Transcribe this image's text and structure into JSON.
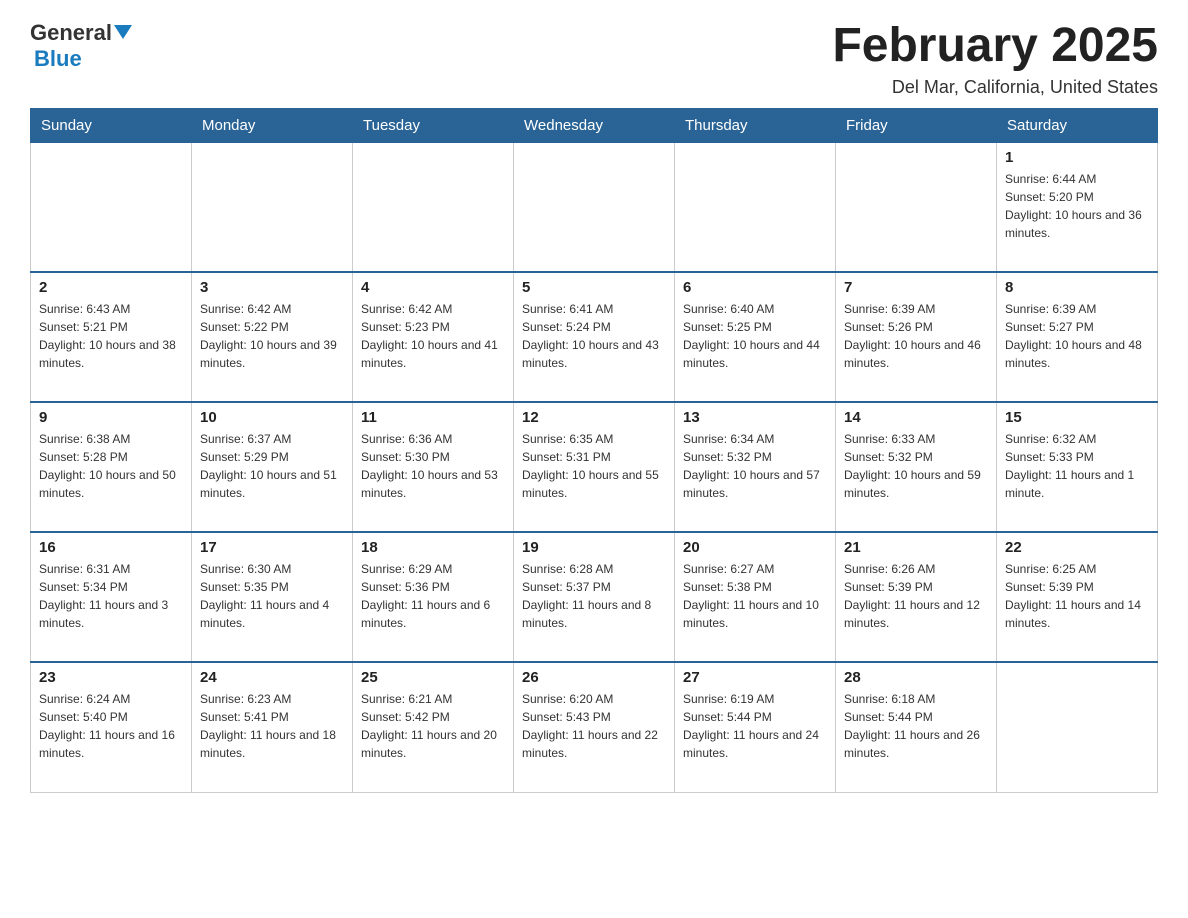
{
  "header": {
    "logo_general": "General",
    "logo_blue": "Blue",
    "month_title": "February 2025",
    "location": "Del Mar, California, United States"
  },
  "weekdays": [
    "Sunday",
    "Monday",
    "Tuesday",
    "Wednesday",
    "Thursday",
    "Friday",
    "Saturday"
  ],
  "weeks": [
    [
      {
        "day": "",
        "info": ""
      },
      {
        "day": "",
        "info": ""
      },
      {
        "day": "",
        "info": ""
      },
      {
        "day": "",
        "info": ""
      },
      {
        "day": "",
        "info": ""
      },
      {
        "day": "",
        "info": ""
      },
      {
        "day": "1",
        "info": "Sunrise: 6:44 AM\nSunset: 5:20 PM\nDaylight: 10 hours and 36 minutes."
      }
    ],
    [
      {
        "day": "2",
        "info": "Sunrise: 6:43 AM\nSunset: 5:21 PM\nDaylight: 10 hours and 38 minutes."
      },
      {
        "day": "3",
        "info": "Sunrise: 6:42 AM\nSunset: 5:22 PM\nDaylight: 10 hours and 39 minutes."
      },
      {
        "day": "4",
        "info": "Sunrise: 6:42 AM\nSunset: 5:23 PM\nDaylight: 10 hours and 41 minutes."
      },
      {
        "day": "5",
        "info": "Sunrise: 6:41 AM\nSunset: 5:24 PM\nDaylight: 10 hours and 43 minutes."
      },
      {
        "day": "6",
        "info": "Sunrise: 6:40 AM\nSunset: 5:25 PM\nDaylight: 10 hours and 44 minutes."
      },
      {
        "day": "7",
        "info": "Sunrise: 6:39 AM\nSunset: 5:26 PM\nDaylight: 10 hours and 46 minutes."
      },
      {
        "day": "8",
        "info": "Sunrise: 6:39 AM\nSunset: 5:27 PM\nDaylight: 10 hours and 48 minutes."
      }
    ],
    [
      {
        "day": "9",
        "info": "Sunrise: 6:38 AM\nSunset: 5:28 PM\nDaylight: 10 hours and 50 minutes."
      },
      {
        "day": "10",
        "info": "Sunrise: 6:37 AM\nSunset: 5:29 PM\nDaylight: 10 hours and 51 minutes."
      },
      {
        "day": "11",
        "info": "Sunrise: 6:36 AM\nSunset: 5:30 PM\nDaylight: 10 hours and 53 minutes."
      },
      {
        "day": "12",
        "info": "Sunrise: 6:35 AM\nSunset: 5:31 PM\nDaylight: 10 hours and 55 minutes."
      },
      {
        "day": "13",
        "info": "Sunrise: 6:34 AM\nSunset: 5:32 PM\nDaylight: 10 hours and 57 minutes."
      },
      {
        "day": "14",
        "info": "Sunrise: 6:33 AM\nSunset: 5:32 PM\nDaylight: 10 hours and 59 minutes."
      },
      {
        "day": "15",
        "info": "Sunrise: 6:32 AM\nSunset: 5:33 PM\nDaylight: 11 hours and 1 minute."
      }
    ],
    [
      {
        "day": "16",
        "info": "Sunrise: 6:31 AM\nSunset: 5:34 PM\nDaylight: 11 hours and 3 minutes."
      },
      {
        "day": "17",
        "info": "Sunrise: 6:30 AM\nSunset: 5:35 PM\nDaylight: 11 hours and 4 minutes."
      },
      {
        "day": "18",
        "info": "Sunrise: 6:29 AM\nSunset: 5:36 PM\nDaylight: 11 hours and 6 minutes."
      },
      {
        "day": "19",
        "info": "Sunrise: 6:28 AM\nSunset: 5:37 PM\nDaylight: 11 hours and 8 minutes."
      },
      {
        "day": "20",
        "info": "Sunrise: 6:27 AM\nSunset: 5:38 PM\nDaylight: 11 hours and 10 minutes."
      },
      {
        "day": "21",
        "info": "Sunrise: 6:26 AM\nSunset: 5:39 PM\nDaylight: 11 hours and 12 minutes."
      },
      {
        "day": "22",
        "info": "Sunrise: 6:25 AM\nSunset: 5:39 PM\nDaylight: 11 hours and 14 minutes."
      }
    ],
    [
      {
        "day": "23",
        "info": "Sunrise: 6:24 AM\nSunset: 5:40 PM\nDaylight: 11 hours and 16 minutes."
      },
      {
        "day": "24",
        "info": "Sunrise: 6:23 AM\nSunset: 5:41 PM\nDaylight: 11 hours and 18 minutes."
      },
      {
        "day": "25",
        "info": "Sunrise: 6:21 AM\nSunset: 5:42 PM\nDaylight: 11 hours and 20 minutes."
      },
      {
        "day": "26",
        "info": "Sunrise: 6:20 AM\nSunset: 5:43 PM\nDaylight: 11 hours and 22 minutes."
      },
      {
        "day": "27",
        "info": "Sunrise: 6:19 AM\nSunset: 5:44 PM\nDaylight: 11 hours and 24 minutes."
      },
      {
        "day": "28",
        "info": "Sunrise: 6:18 AM\nSunset: 5:44 PM\nDaylight: 11 hours and 26 minutes."
      },
      {
        "day": "",
        "info": ""
      }
    ]
  ]
}
